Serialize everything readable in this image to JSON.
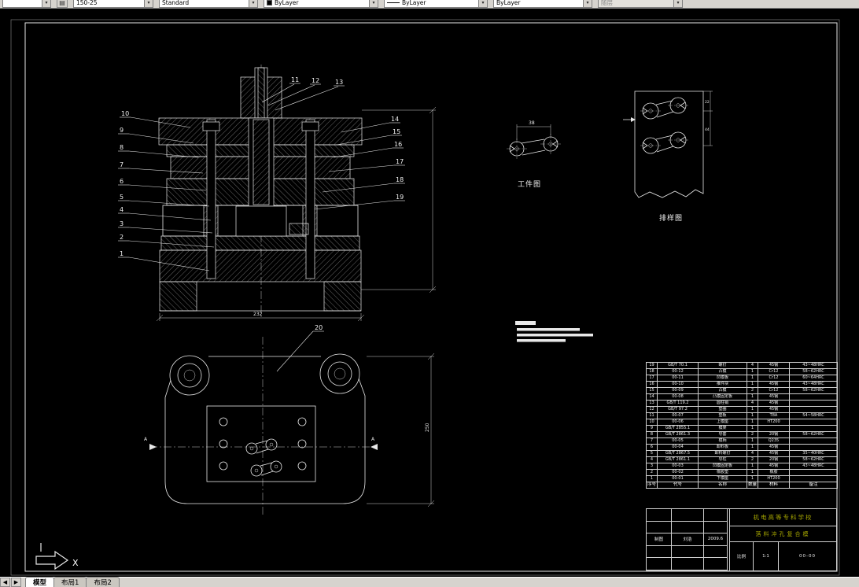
{
  "colors": {
    "canvas_bg": "#000000",
    "line": "#e8e8e8",
    "title_accent": "#a8a800",
    "toolbar_bg": "#d6d3ce"
  },
  "toolbar": {
    "layer_value": "",
    "dim_style": "150-25",
    "text_style": "Standard",
    "color": "ByLayer",
    "linetype": "ByLayer",
    "lineweight": "ByLayer",
    "plot_style": "随层"
  },
  "tabs": {
    "nav_prev": "◀",
    "nav_next": "▶",
    "items": [
      {
        "label": "模型",
        "active": true
      },
      {
        "label": "布局1",
        "active": false
      },
      {
        "label": "布局2",
        "active": false
      }
    ]
  },
  "ucs": {
    "x_label": "X"
  },
  "views": {
    "workpiece_label": "工件图",
    "strip_label": "排样图"
  },
  "dims": {
    "section_width": "232",
    "plan_height": "250",
    "workpiece_width": "38",
    "strip_edge": "22",
    "strip_pitch": "44",
    "section_mark": "A"
  },
  "balloons": {
    "left": [
      "10",
      "9",
      "8",
      "7",
      "6",
      "5",
      "4",
      "3",
      "2",
      "1"
    ],
    "top": [
      "11",
      "12",
      "13"
    ],
    "right": [
      "14",
      "15",
      "16",
      "17",
      "18",
      "19"
    ],
    "plan": [
      "20"
    ]
  },
  "parts_table": {
    "header": [
      "序号",
      "代号",
      "名称",
      "数量",
      "材料",
      "备注"
    ],
    "rows": [
      [
        "19",
        "GB/T 70.1",
        "螺钉",
        "4",
        "45钢",
        "43~48HRC"
      ],
      [
        "18",
        "00-12",
        "凸模",
        "1",
        "Cr12",
        "58~62HRC"
      ],
      [
        "17",
        "00-11",
        "凹模板",
        "1",
        "Cr12",
        "60~64HRC"
      ],
      [
        "16",
        "00-10",
        "推件块",
        "1",
        "45钢",
        "43~48HRC"
      ],
      [
        "15",
        "00-09",
        "凸模",
        "2",
        "Cr12",
        "58~62HRC"
      ],
      [
        "14",
        "00-08",
        "凸模固定板",
        "1",
        "45钢",
        ""
      ],
      [
        "13",
        "GB/T 119.2",
        "圆柱销",
        "4",
        "45钢",
        ""
      ],
      [
        "12",
        "GB/T 97.2",
        "垫圈",
        "1",
        "45钢",
        ""
      ],
      [
        "11",
        "00-07",
        "垫板",
        "1",
        "T8A",
        "54~58HRC"
      ],
      [
        "10",
        "00-06",
        "上模座",
        "1",
        "HT200",
        ""
      ],
      [
        "9",
        "GB/T 2855.1",
        "模架",
        "1",
        "",
        ""
      ],
      [
        "8",
        "GB/T 2861.3",
        "导套",
        "2",
        "20钢",
        "58~62HRC"
      ],
      [
        "7",
        "00-05",
        "模柄",
        "1",
        "Q235",
        ""
      ],
      [
        "6",
        "00-04",
        "卸料板",
        "1",
        "45钢",
        ""
      ],
      [
        "5",
        "GB/T 2867.5",
        "卸料螺钉",
        "4",
        "45钢",
        "35~40HRC"
      ],
      [
        "4",
        "GB/T 2861.1",
        "导柱",
        "2",
        "20钢",
        "58~62HRC"
      ],
      [
        "3",
        "00-03",
        "凹模固定板",
        "1",
        "45钢",
        "43~48HRC"
      ],
      [
        "2",
        "00-02",
        "橡胶垫",
        "1",
        "橡胶",
        ""
      ],
      [
        "1",
        "00-01",
        "下模座",
        "1",
        "HT200",
        ""
      ]
    ]
  },
  "title_block": {
    "school": "机电高等专科学校",
    "drawing_title": "落料冲孔复合模",
    "scale_label": "比例",
    "scale": "1:1",
    "drawing_no": "00-00",
    "sig_rows": [
      [
        "",
        "",
        ""
      ],
      [
        "",
        "",
        ""
      ],
      [
        "制图",
        "刘浩",
        "2009.6"
      ],
      [
        "",
        "",
        ""
      ],
      [
        "",
        "",
        ""
      ]
    ]
  }
}
